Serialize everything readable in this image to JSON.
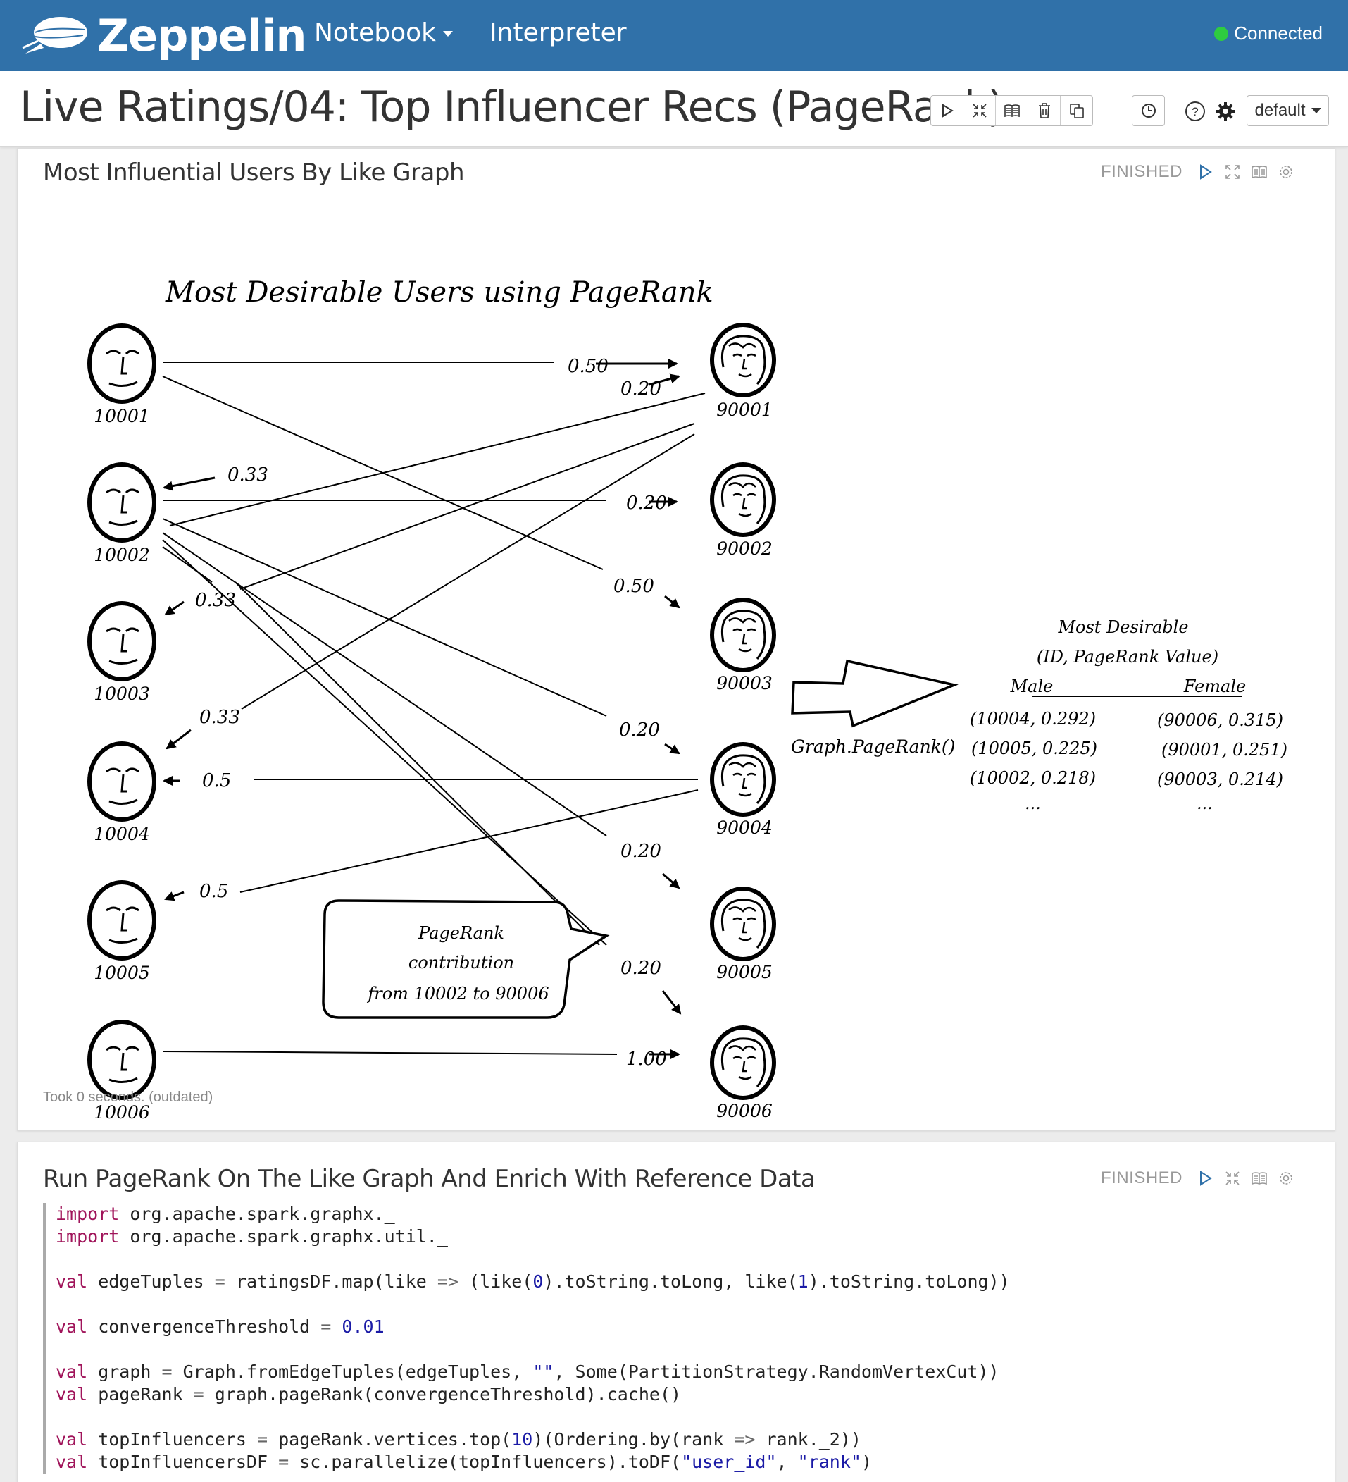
{
  "app": {
    "brand": "Zeppelin",
    "nav": {
      "notebook": "Notebook",
      "interpreter": "Interpreter"
    },
    "status": "Connected",
    "status_color": "#2ecc40",
    "header_color": "#3071a9"
  },
  "notebook": {
    "title": "Live Ratings/04: Top Influencer Recs (PageRank)",
    "interpreter_binding": "default"
  },
  "paragraphs": [
    {
      "title": "Most Influential Users By Like Graph",
      "status": "FINISHED",
      "took": "Took 0 seconds. (outdated)",
      "drawing": {
        "heading": "Most Desirable Users using PageRank",
        "left_users": [
          "10001",
          "10002",
          "10003",
          "10004",
          "10005",
          "10006"
        ],
        "right_users": [
          "90001",
          "90002",
          "90003",
          "90004",
          "90005",
          "90006"
        ],
        "edge_labels": {
          "e1": "0.50",
          "e2": "0.20",
          "e3": "0.33",
          "e4": "0.20",
          "e5": "0.50",
          "e6": "0.33",
          "e7": "0.33",
          "e8": "0.20",
          "e9": "0.5",
          "e10": "0.5",
          "e11": "0.20",
          "e12": "0.20",
          "e13": "1.00"
        },
        "callout": [
          "PageRank",
          "contribution",
          "from 10002 to 90006"
        ],
        "arrow_label": "Graph.PageRank()",
        "result": {
          "title": "Most Desirable",
          "subtitle": "(ID, PageRank Value)",
          "male_header": "Male",
          "female_header": "Female",
          "male": [
            "(10004, 0.292)",
            "(10005, 0.225)",
            "(10002, 0.218)",
            "..."
          ],
          "female": [
            "(90006, 0.315)",
            "(90001, 0.251)",
            "(90003, 0.214)",
            "..."
          ]
        }
      }
    },
    {
      "title": "Run PageRank On The Like Graph And Enrich With Reference Data",
      "status": "FINISHED",
      "code": {
        "l1a": "import",
        "l1b": " org.apache.spark.graphx._",
        "l2a": "import",
        "l2b": " org.apache.spark.graphx.util._",
        "l3a": "val",
        "l3b": " edgeTuples ",
        "l3c": "=",
        "l3d": " ratingsDF.map(like ",
        "l3e": "=>",
        "l3f": " (like(",
        "l3g": "0",
        "l3h": ").toString.toLong, like(",
        "l3i": "1",
        "l3j": ").toString.toLong))",
        "l4a": "val",
        "l4b": " convergenceThreshold ",
        "l4c": "=",
        "l4d": " ",
        "l4e": "0.01",
        "l5a": "val",
        "l5b": " graph ",
        "l5c": "=",
        "l5d": " Graph.fromEdgeTuples(edgeTuples, ",
        "l5e": "\"\"",
        "l5f": ", Some(PartitionStrategy.RandomVertexCut))",
        "l6a": "val",
        "l6b": " pageRank ",
        "l6c": "=",
        "l6d": " graph.pageRank(convergenceThreshold).cache()",
        "l7a": "val",
        "l7b": " topInfluencers ",
        "l7c": "=",
        "l7d": " pageRank.vertices.top(",
        "l7e": "10",
        "l7f": ")(Ordering.by(rank ",
        "l7g": "=>",
        "l7h": " rank._2))",
        "l8a": "val",
        "l8b": " topInfluencersDF ",
        "l8c": "=",
        "l8d": " sc.parallelize(topInfluencers).toDF(",
        "l8e": "\"user_id\"",
        "l8f": ", ",
        "l8g": "\"rank\"",
        "l8h": ")"
      }
    }
  ]
}
